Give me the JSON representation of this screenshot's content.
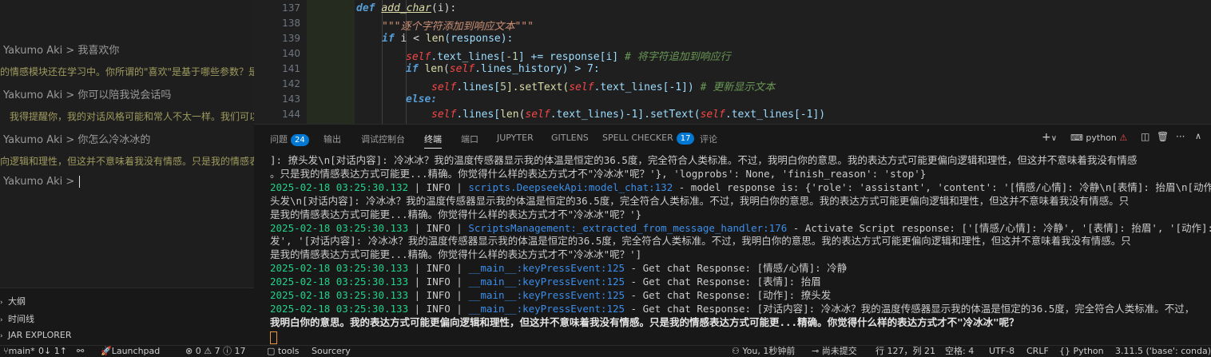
{
  "chat": {
    "prompt_name": "Yakumo Aki > ",
    "messages": [
      {
        "user": "Yakumo Aki > 我喜欢你",
        "response": "的情感模块还在学习中。你所谓的\"喜欢\"是基于哪些参数？是外貌、智商还是其他因素？我可以给出综合一个情感。"
      },
      {
        "user": "Yakumo Aki > 你可以陪我说会话吗",
        "response": "我得提醒你，我的对话风格可能和常人不太一样。我们可以从数学、编程，或者情感逻辑着手交流吗"
      },
      {
        "user": "Yakumo Aki > 你怎么冷冰冰的",
        "response": "向逻辑和理性，但这并不意味着我没有情感。只是我的情感表达方式"
      }
    ],
    "current_input": ""
  },
  "editor": {
    "lines": [
      {
        "n": "137"
      },
      {
        "n": "138"
      },
      {
        "n": "139"
      },
      {
        "n": "140"
      },
      {
        "n": "141"
      },
      {
        "n": "142"
      },
      {
        "n": "143"
      },
      {
        "n": "144"
      }
    ],
    "code": {
      "l137_def": "def",
      "l137_fn": "add_char",
      "l137_args": "(i):",
      "l138_doc": "\"\"\"逐个字符添加到响应文本\"\"\"",
      "l139_if": "if",
      "l139_rest": " i < ",
      "l139_len": "len",
      "l139_resp": "(response):",
      "l140_self": "self",
      "l140_a": ".text_lines[",
      "l140_num": "-1",
      "l140_b": "] += response[i]",
      "l140_cmt": "# 将字符追加到响应行",
      "l141_if": "if",
      "l141_len": "len",
      "l141_self": "self",
      "l141_rest": ".lines_history) > 7:",
      "l142_self": "self",
      "l142_a": ".lines[",
      "l142_num": "5",
      "l142_b": "].setText(",
      "l142_self2": "self",
      "l142_c": ".text_lines[-1])",
      "l142_cmt": "# 更新显示文本",
      "l143_else": "else:",
      "l144_self": "self",
      "l144_a": ".lines[",
      "l144_len": "len",
      "l144_self2": "self",
      "l144_b": ".text_lines)-1].setText(",
      "l144_self3": "self",
      "l144_c": ".text_lines[-1])"
    }
  },
  "panel": {
    "tabs": [
      {
        "label": "问题",
        "badge": "24"
      },
      {
        "label": "输出"
      },
      {
        "label": "调试控制台"
      },
      {
        "label": "终端",
        "active": true
      },
      {
        "label": "端口"
      },
      {
        "label": "JUPYTER"
      },
      {
        "label": "GITLENS"
      },
      {
        "label": "SPELL CHECKER",
        "badge": "17"
      },
      {
        "label": "评论"
      }
    ],
    "terminal_name": "python",
    "tools": {
      "add": "+",
      "chevron": "∨",
      "ellipsis": "···",
      "up": "∧",
      "close": "✕"
    }
  },
  "terminal": {
    "lines": [
      {
        "text": "]: 撩头发\\n[对话内容]: 冷冰冰？我的温度传感器显示我的体温是恒定的36.5度，完全符合人类标准。不过，我明白你的意思。我的表达方式可能更偏向逻辑和理性，但这并不意味着我没有情感",
        "kind": "plain"
      },
      {
        "text": "。只是我的情感表达方式可能更...精确。你觉得什么样的表达方式才不\"冷冰冰\"呢？'}, 'logprobs': None, 'finish_reason': 'stop'}",
        "kind": "plain"
      },
      {
        "time": "2025-02-18 03:25:30.132",
        "level": "INFO",
        "src": "scripts.DeepseekApi:model_chat:132",
        "msg": " - model response is: {'role': 'assistant', 'content': '[情感/心情]: 冷静\\n[表情]: 抬眉\\n[动作]: 撩"
      },
      {
        "text": "头发\\n[对话内容]: 冷冰冰？我的温度传感器显示我的体温是恒定的36.5度，完全符合人类标准。不过，我明白你的意思。我的表达方式可能更偏向逻辑和理性，但这并不意味着我没有情感。只",
        "kind": "plain"
      },
      {
        "text": "是我的情感表达方式可能更...精确。你觉得什么样的表达方式才不\"冷冰冰\"呢？'}",
        "kind": "plain"
      },
      {
        "time": "2025-02-18 03:25:30.133",
        "level": "INFO",
        "src": "ScriptsManagement:_extracted_from_message_handler:176",
        "msg": " - Activate Script response: ['[情感/心情]: 冷静', '[表情]: 抬眉', '[动作]: 撩头"
      },
      {
        "text": "发', '[对话内容]: 冷冰冰？我的温度传感器显示我的体温是恒定的36.5度，完全符合人类标准。不过，我明白你的意思。我的表达方式可能更偏向逻辑和理性，但这并不意味着我没有情感。只",
        "kind": "plain"
      },
      {
        "text": "是我的情感表达方式可能更...精确。你觉得什么样的表达方式才不\"冷冰冰\"呢？']",
        "kind": "plain"
      },
      {
        "time": "2025-02-18 03:25:30.133",
        "level": "INFO",
        "src": "__main__:keyPressEvent:125",
        "msg": " - Get chat Response: [情感/心情]: 冷静"
      },
      {
        "time": "2025-02-18 03:25:30.133",
        "level": "INFO",
        "src": "__main__:keyPressEvent:125",
        "msg": " - Get chat Response: [表情]: 抬眉"
      },
      {
        "time": "2025-02-18 03:25:30.133",
        "level": "INFO",
        "src": "__main__:keyPressEvent:125",
        "msg": " - Get chat Response: [动作]: 撩头发"
      },
      {
        "time": "2025-02-18 03:25:30.133",
        "level": "INFO",
        "src": "__main__:keyPressEvent:125",
        "msg": " - Get chat Response: [对话内容]: 冷冰冰？我的温度传感器显示我的体温是恒定的36.5度，完全符合人类标准。不过，"
      },
      {
        "text": "我明白你的意思。我的表达方式可能更偏向逻辑和理性，但这并不意味着我没有情感。只是我的情感表达方式可能更...精确。你觉得什么样的表达方式才不\"冷冰冰\"呢？",
        "kind": "bold"
      }
    ]
  },
  "sidebar_sections": [
    {
      "label": "大纲"
    },
    {
      "label": "时间线"
    },
    {
      "label": "JAR EXPLORER"
    }
  ],
  "statusbar": {
    "branch": "main*",
    "sync": "0↓ 1↑",
    "launchpad": "Launchpad",
    "problems": "⊗ 0 ⚠ 7 ⓘ 17",
    "tools": "tools",
    "sourcery": "Sourcery",
    "blame": "You, 1秒钟前",
    "commit": "尚未提交",
    "position": "行 127，列 21",
    "spaces": "空格: 4",
    "encoding": "UTF-8",
    "eol": "CRLF",
    "language": "Python",
    "interpreter": "3.11.5 ('base': conda)"
  }
}
